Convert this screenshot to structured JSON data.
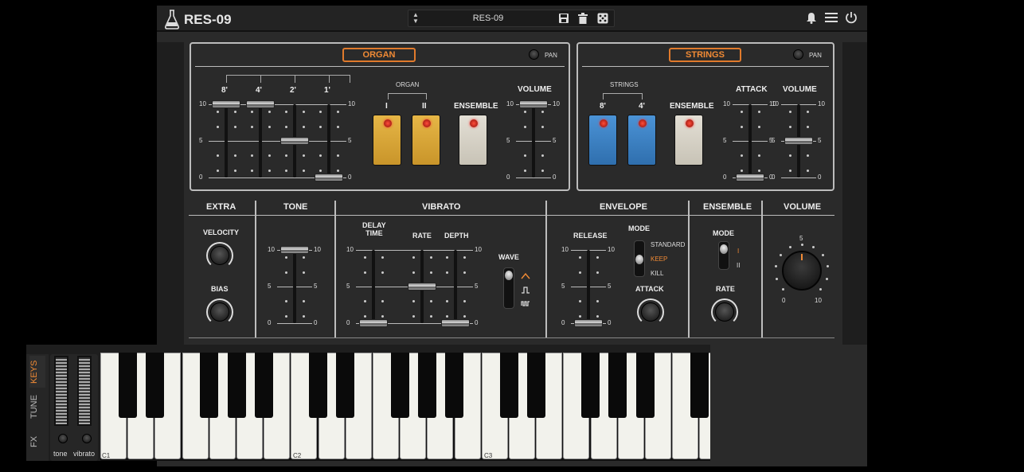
{
  "app": {
    "title": "RES-09"
  },
  "preset": {
    "name": "RES-09"
  },
  "organ": {
    "label": "ORGAN",
    "pan": "PAN",
    "footages": [
      "8'",
      "4'",
      "2'",
      "1'"
    ],
    "group": "ORGAN",
    "tabs": [
      "I",
      "II"
    ],
    "ensemble": "ENSEMBLE",
    "volume": "VOLUME"
  },
  "strings": {
    "label": "STRINGS",
    "pan": "PAN",
    "group": "STRINGS",
    "footages": [
      "8'",
      "4'"
    ],
    "ensemble": "ENSEMBLE",
    "attack": "ATTACK",
    "volume": "VOLUME"
  },
  "scale": {
    "top": "10",
    "mid": "5",
    "bot": "0"
  },
  "extra": {
    "label": "EXTRA",
    "velocity": "VELOCITY",
    "bias": "BIAS"
  },
  "tone": {
    "label": "TONE"
  },
  "vibrato": {
    "label": "VIBRATO",
    "delay": "DELAY\nTIME",
    "rate": "RATE",
    "depth": "DEPTH",
    "wave": "WAVE"
  },
  "envelope": {
    "label": "ENVELOPE",
    "release": "RELEASE",
    "mode": "MODE",
    "modes": [
      "STANDARD",
      "KEEP",
      "KILL"
    ],
    "attack": "ATTACK"
  },
  "ensemble2": {
    "label": "ENSEMBLE",
    "mode": "MODE",
    "opts": [
      "I",
      "II"
    ],
    "rate": "RATE"
  },
  "volume2": {
    "label": "VOLUME",
    "min": "0",
    "mid": "5",
    "max": "10"
  },
  "keyboard": {
    "tabs": [
      "KEYS",
      "TUNE",
      "FX"
    ],
    "knobs": [
      "tone",
      "vibrato"
    ],
    "octaves": [
      "C1",
      "C2",
      "C3"
    ]
  },
  "colors": {
    "accent": "#f08a35",
    "organTab": "#d9a533",
    "stringsTab": "#3f86c9",
    "ensembleTab": "#d9d4c8"
  }
}
